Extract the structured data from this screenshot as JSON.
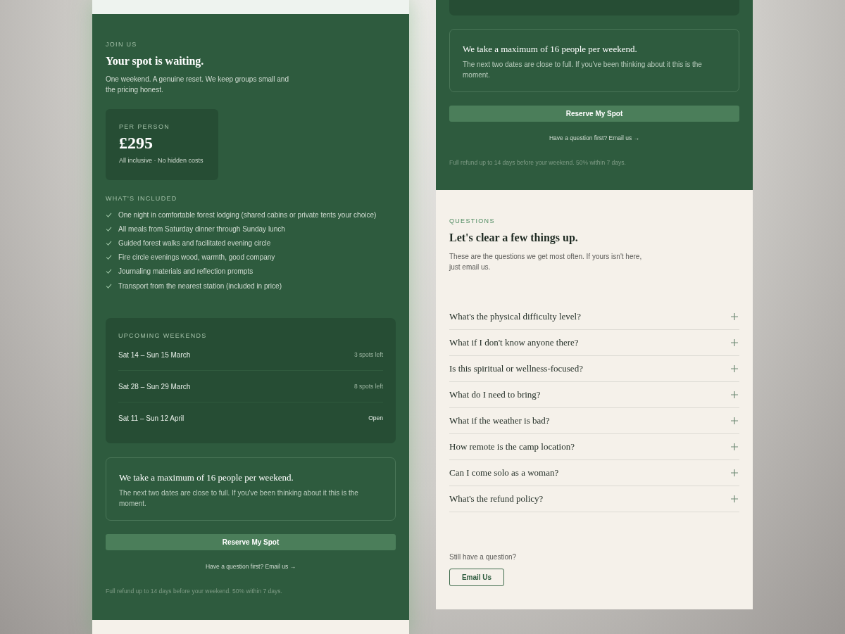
{
  "booking_panel": {
    "eyebrow": "JOIN US",
    "heading": "Your spot is waiting.",
    "intro": "One weekend. A genuine reset. We keep groups small and the pricing honest.",
    "price_card": {
      "label": "PER PERSON",
      "price": "£295",
      "note": "All inclusive · No hidden costs"
    },
    "included": {
      "label": "WHAT'S INCLUDED",
      "items": [
        "One night in comfortable forest lodging (shared cabins or private tents your choice)",
        "All meals from Saturday dinner through Sunday lunch",
        "Guided forest walks and facilitated evening circle",
        "Fire circle evenings wood, warmth, good company",
        "Journaling materials and reflection prompts",
        "Transport from the nearest station (included in price)"
      ]
    },
    "weekends": {
      "label": "UPCOMING WEEKENDS",
      "rows": [
        {
          "dates": "Sat 14 – Sun 15 March",
          "status": "3 spots left",
          "open": false
        },
        {
          "dates": "Sat 28 – Sun 29 March",
          "status": "8 spots left",
          "open": false
        },
        {
          "dates": "Sat 11 – Sun 12 April",
          "status": "Open",
          "open": true
        }
      ]
    },
    "capacity_note": {
      "title": "We take a maximum of 16 people per weekend.",
      "text": "The next two dates are close to full. If you've been thinking about it  this is the moment."
    },
    "reserve_button": "Reserve My Spot",
    "email_link": "Have a question first? Email us →",
    "refund_note": "Full refund up to 14 days before your weekend. 50% within 7 days."
  },
  "booking_panel_continued": {
    "capacity_note": {
      "title": "We take a maximum of 16 people per weekend.",
      "text": "The next two dates are close to full. If you've been thinking about it this is the moment."
    },
    "reserve_button": "Reserve My Spot",
    "email_link": "Have a question first? Email us →",
    "refund_note": "Full refund up to 14 days before your weekend. 50% within 7 days."
  },
  "faq": {
    "eyebrow": "QUESTIONS",
    "heading": "Let's clear a few things up.",
    "intro": "These are the questions we get most often. If yours isn't here, just email us.",
    "items": [
      {
        "question": "What's the physical difficulty level?",
        "expanded": false
      },
      {
        "question": "What if I don't know anyone there?",
        "expanded": false
      },
      {
        "question": "Is this spiritual or wellness-focused?",
        "expanded": false
      },
      {
        "question": "What do I need to bring?",
        "expanded": false
      },
      {
        "question": "What if the weather is bad?",
        "expanded": false
      },
      {
        "question": "How remote is the camp location?",
        "expanded": false
      },
      {
        "question": "Can I come solo as a woman?",
        "expanded": false
      },
      {
        "question": "What's the refund policy?",
        "expanded": false
      }
    ],
    "still_label": "Still have a question?",
    "email_button": "Email Us"
  }
}
